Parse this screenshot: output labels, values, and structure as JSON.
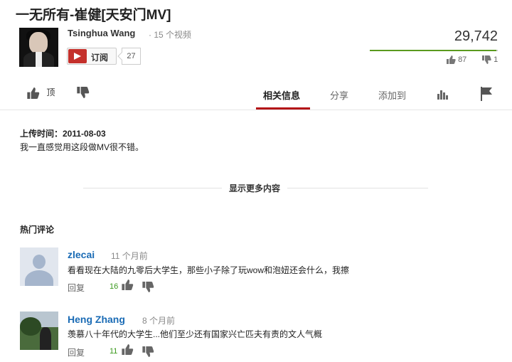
{
  "video": {
    "title": "一无所有-崔健[天安门MV]"
  },
  "channel": {
    "name": "Tsinghua Wang",
    "video_count": "· 15 个视频",
    "subscribe_label": "订阅",
    "subscriber_count": "27"
  },
  "stats": {
    "views": "29,742",
    "likes": "87",
    "dislikes": "1",
    "like_ratio": 0.99,
    "like_bar_color": "#5a9a1e"
  },
  "actions": {
    "like_label": "顶",
    "tabs": [
      "相关信息",
      "分享",
      "添加到"
    ],
    "active_tab_color": "#b31217"
  },
  "description": {
    "upload_time": "上传时间：2011-08-03",
    "text": "我一直感觉用这段做MV很不错。",
    "show_more": "显示更多内容"
  },
  "comments": {
    "title": "热门评论",
    "items": [
      {
        "author": "zlecai",
        "time": "11 个月前",
        "text": "看看现在大陆的九零后大学生，那些小子除了玩wow和泡妞还会什么，我擦",
        "reply": "回复",
        "likes": "16"
      },
      {
        "author": "Heng Zhang",
        "time": "8 个月前",
        "text": "羡慕八十年代的大学生...他们至少还有国家兴亡匹夫有责的文人气概",
        "reply": "回复",
        "likes": "11"
      }
    ]
  },
  "icons": [
    "thumbs-up-icon",
    "thumbs-down-icon",
    "stats-icon",
    "flag-icon",
    "youtube-icon"
  ]
}
